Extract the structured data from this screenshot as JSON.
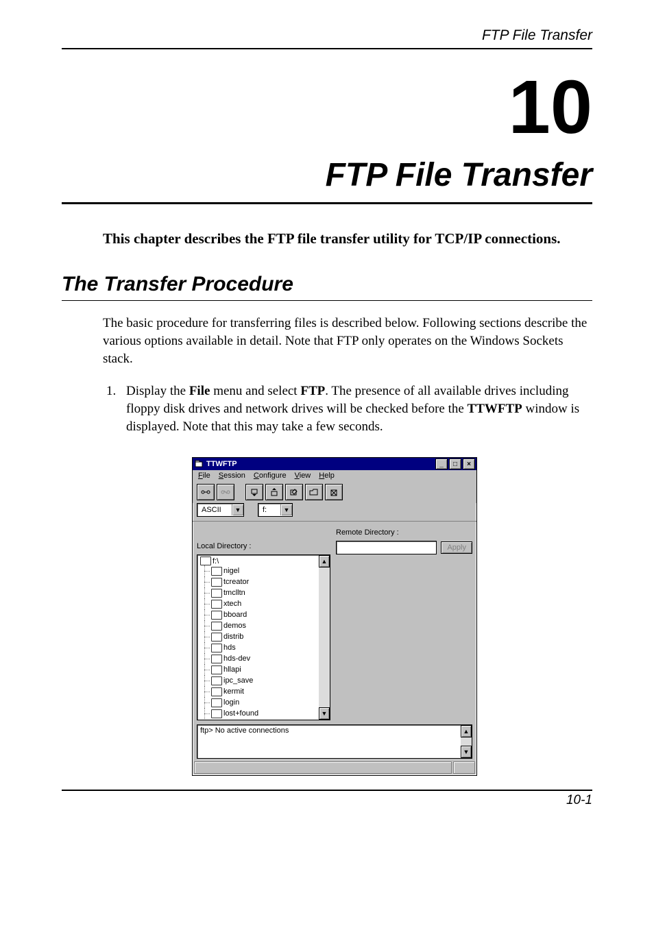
{
  "header": {
    "running": "FTP File Transfer"
  },
  "chapter": {
    "number": "10",
    "title": "FTP File Transfer"
  },
  "intro": "This chapter describes the FTP file transfer utility for TCP/IP connections.",
  "section": {
    "title": "The Transfer Procedure"
  },
  "para1": "The basic procedure for transferring files is described below. Following sections describe the various options available in detail. Note that FTP only operates on the Windows Sockets stack.",
  "step1_a": "Display the ",
  "step1_b": "File",
  "step1_c": " menu and select ",
  "step1_d": "FTP",
  "step1_e": ". The presence of all available drives including floppy disk drives and network drives will be checked before the ",
  "step1_f": "TTWFTP",
  "step1_g": " window is displayed. Note that this may take a few seconds.",
  "footer": {
    "page": "10-1"
  },
  "window": {
    "title": "TTWFTP",
    "menus": {
      "file": "File",
      "session": "Session",
      "configure": "Configure",
      "view": "View",
      "help": "Help"
    },
    "mode": "ASCII",
    "drive": "f:",
    "localLabel": "Local Directory :",
    "remoteLabel": "Remote Directory :",
    "apply": "Apply",
    "treeRoot": "f:\\",
    "tree": [
      "nigel",
      "tcreator",
      "tmclltn",
      "xtech",
      "bboard",
      "demos",
      "distrib",
      "hds",
      "hds-dev",
      "hllapi",
      "ipc_save",
      "kermit",
      "login",
      "lost+found"
    ],
    "console": "ftp> No active connections"
  }
}
